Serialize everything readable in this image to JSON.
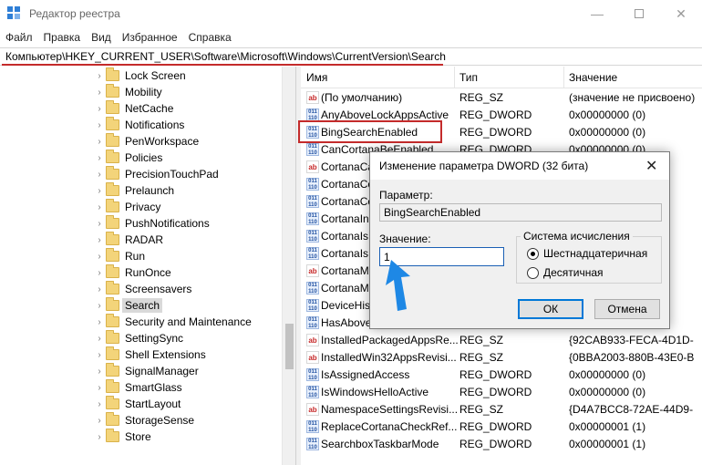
{
  "window": {
    "title": "Редактор реестра",
    "controls": {
      "minimize": "—",
      "maximize": "",
      "close": "✕"
    }
  },
  "menu": [
    "Файл",
    "Правка",
    "Вид",
    "Избранное",
    "Справка"
  ],
  "address": "Компьютер\\HKEY_CURRENT_USER\\Software\\Microsoft\\Windows\\CurrentVersion\\Search",
  "tree": {
    "items": [
      {
        "label": "Lock Screen"
      },
      {
        "label": "Mobility"
      },
      {
        "label": "NetCache"
      },
      {
        "label": "Notifications"
      },
      {
        "label": "PenWorkspace"
      },
      {
        "label": "Policies"
      },
      {
        "label": "PrecisionTouchPad"
      },
      {
        "label": "Prelaunch"
      },
      {
        "label": "Privacy"
      },
      {
        "label": "PushNotifications"
      },
      {
        "label": "RADAR"
      },
      {
        "label": "Run"
      },
      {
        "label": "RunOnce"
      },
      {
        "label": "Screensavers"
      },
      {
        "label": "Search",
        "selected": true
      },
      {
        "label": "Security and Maintenance"
      },
      {
        "label": "SettingSync"
      },
      {
        "label": "Shell Extensions"
      },
      {
        "label": "SignalManager"
      },
      {
        "label": "SmartGlass"
      },
      {
        "label": "StartLayout"
      },
      {
        "label": "StorageSense"
      },
      {
        "label": "Store"
      }
    ]
  },
  "list": {
    "columns": [
      "Имя",
      "Тип",
      "Значение"
    ],
    "rows": [
      {
        "icon": "ab",
        "name": "(По умолчанию)",
        "type": "REG_SZ",
        "data": "(значение не присвоено)"
      },
      {
        "icon": "bin",
        "name": "AnyAboveLockAppsActive",
        "type": "REG_DWORD",
        "data": "0x00000000 (0)"
      },
      {
        "icon": "bin",
        "name": "BingSearchEnabled",
        "type": "REG_DWORD",
        "data": "0x00000000 (0)"
      },
      {
        "icon": "bin",
        "name": "CanCortanaBeEnabled",
        "type": "REG_DWORD",
        "data": "0x00000000 (0)"
      },
      {
        "icon": "ab",
        "name": "CortanaCa",
        "type": "",
        "data": ""
      },
      {
        "icon": "bin",
        "name": "CortanaCo",
        "type": "",
        "data": ""
      },
      {
        "icon": "bin",
        "name": "CortanaCo",
        "type": "",
        "data": ""
      },
      {
        "icon": "bin",
        "name": "CortanaIn",
        "type": "",
        "data": ""
      },
      {
        "icon": "bin",
        "name": "CortanaIs",
        "type": "",
        "data": ""
      },
      {
        "icon": "bin",
        "name": "CortanaIs",
        "type": "",
        "data": ""
      },
      {
        "icon": "ab",
        "name": "CortanaM",
        "type": "",
        "data": "4d"
      },
      {
        "icon": "bin",
        "name": "CortanaM",
        "type": "",
        "data": "00"
      },
      {
        "icon": "bin",
        "name": "DeviceHis",
        "type": "",
        "data": ""
      },
      {
        "icon": "bin",
        "name": "HasAbove",
        "type": "",
        "data": ""
      },
      {
        "icon": "ab",
        "name": "InstalledPackagedAppsRe...",
        "type": "REG_SZ",
        "data": "{92CAB933-FECA-4D1D-"
      },
      {
        "icon": "ab",
        "name": "InstalledWin32AppsRevisi...",
        "type": "REG_SZ",
        "data": "{0BBA2003-880B-43E0-B"
      },
      {
        "icon": "bin",
        "name": "IsAssignedAccess",
        "type": "REG_DWORD",
        "data": "0x00000000 (0)"
      },
      {
        "icon": "bin",
        "name": "IsWindowsHelloActive",
        "type": "REG_DWORD",
        "data": "0x00000000 (0)"
      },
      {
        "icon": "ab",
        "name": "NamespaceSettingsRevisi...",
        "type": "REG_SZ",
        "data": "{D4A7BCC8-72AE-44D9-"
      },
      {
        "icon": "bin",
        "name": "ReplaceCortanaCheckRef...",
        "type": "REG_DWORD",
        "data": "0x00000001 (1)"
      },
      {
        "icon": "bin",
        "name": "SearchboxTaskbarMode",
        "type": "REG_DWORD",
        "data": "0x00000001 (1)"
      }
    ]
  },
  "dialog": {
    "title": "Изменение параметра DWORD (32 бита)",
    "close": "✕",
    "param_label": "Параметр:",
    "param_value": "BingSearchEnabled",
    "value_label": "Значение:",
    "value": "1",
    "base_group_label": "Система исчисления",
    "radio_hex": "Шестнадцатеричная",
    "radio_dec": "Десятичная",
    "ok": "ОК",
    "cancel": "Отмена"
  },
  "colors": {
    "highlight_red": "#c42b2b",
    "cursor_blue": "#1e88e5",
    "focus_blue": "#0078d7"
  }
}
